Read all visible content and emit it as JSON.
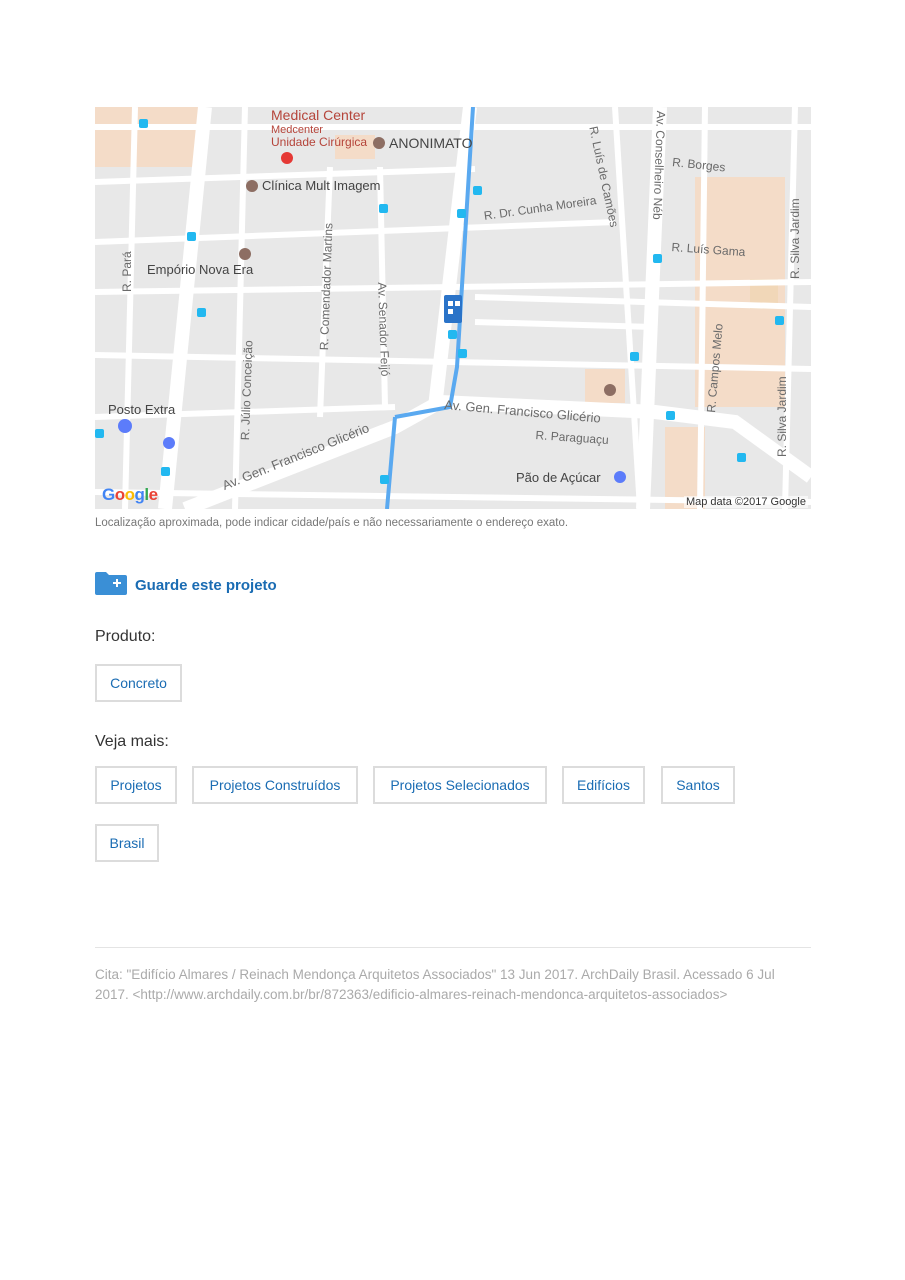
{
  "map": {
    "pois": {
      "medical_center": "Medical Center",
      "medcenter": "Medcenter",
      "unidade": "Unidade Cirúrgica",
      "anonimato": "ANONIMATO",
      "clinica": "Clínica Mult Imagem",
      "emporio": "Empório Nova Era",
      "posto": "Posto Extra",
      "pao": "Pão de Açúcar"
    },
    "streets": {
      "luis_camoes": "R. Luís de Camões",
      "conselheiro": "Av. Conselheiro Néb",
      "borges": "R. Borges",
      "cunha_moreira": "R. Dr. Cunha Moreira",
      "luis_gama": "R. Luís Gama",
      "silva_jardim_top": "R. Silva Jardim",
      "para": "R. Pará",
      "comendador": "R. Comendador Martins",
      "senador": "Av. Senador Feijó",
      "julio": "R. Júlio Conceição",
      "campos_melo": "R. Campos Melo",
      "silva_jardim_bottom": "R. Silva Jardim",
      "glicerio_right": "Av. Gen. Francisco Glicério",
      "glicerio_left": "Av. Gen. Francisco Glicério",
      "paraguacu": "R. Paraguaçu"
    },
    "logo": "Google",
    "attribution": "Map data ©2017 Google"
  },
  "caption": "Localização aproximada, pode indicar cidade/país e não necessariamente o endereço exato.",
  "save": {
    "label": "Guarde este projeto",
    "icon": "folder-plus-icon"
  },
  "produto": {
    "title": "Produto:",
    "tags": [
      "Concreto"
    ]
  },
  "veja": {
    "title": "Veja mais:",
    "tags": [
      "Projetos",
      "Projetos Construídos",
      "Projetos Selecionados",
      "Edifícios",
      "Santos",
      "Brasil"
    ]
  },
  "citation": "Cita: \"Edifício Almares / Reinach Mendonça Arquitetos Associados\" 13 Jun 2017. ArchDaily Brasil. Acessado 6 Jul 2017. <http://www.archdaily.com.br/br/872363/edificio-almares-reinach-mendonca-arquitetos-associados>",
  "colors": {
    "link": "#1a6cb3",
    "road": "#ffffff",
    "land": "#e8e8e8",
    "metro": "#5aa9f0",
    "block": "#f4dcc8"
  }
}
